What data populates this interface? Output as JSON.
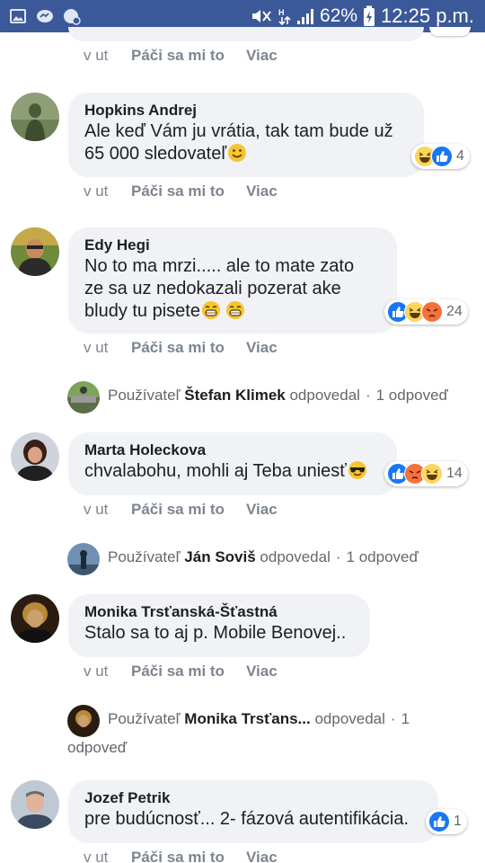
{
  "status": {
    "battery_pct": "62%",
    "time": "12:25 p.m."
  },
  "colors": {
    "facebook_blue": "#3b5998",
    "bubble": "#f0f2f5",
    "like": "#1877f2",
    "meta_gray": "#7d8590"
  },
  "top_actions": {
    "time": "v ut",
    "like": "Páči sa mi to",
    "more": "Viac"
  },
  "comments": [
    {
      "author": "Hopkins Andrej",
      "lines": [
        "Ale keď Vám ju vrátia, tak tam bude už",
        "65 000 sledovateľ"
      ],
      "line_emojis": [
        "",
        "smile"
      ],
      "reactions": [
        "haha",
        "like"
      ],
      "reaction_count": "4",
      "time": "v ut",
      "like": "Páči sa mi to",
      "more": "Viac"
    },
    {
      "author": "Edy Hegi",
      "lines": [
        "No to ma mrzi..... ale to mate zato",
        "ze sa uz nedokazali pozerat ake",
        "bludy tu pisete"
      ],
      "line_emojis": [
        "",
        "",
        "grin grin"
      ],
      "reactions": [
        "like",
        "haha",
        "angry"
      ],
      "reaction_count": "24",
      "time": "v ut",
      "like": "Páči sa mi to",
      "more": "Viac",
      "reply": {
        "prefix": "Používateľ",
        "name": "Štefan Klimek",
        "verb": "odpovedal",
        "count": "1 odpoveď"
      }
    },
    {
      "author": "Marta Holeckova",
      "lines": [
        "chvalabohu, mohli aj Teba uniesť"
      ],
      "line_emojis": [
        "sunglasses"
      ],
      "reactions": [
        "like",
        "angry",
        "haha"
      ],
      "reaction_count": "14",
      "time": "v ut",
      "like": "Páči sa mi to",
      "more": "Viac",
      "reply": {
        "prefix": "Používateľ",
        "name": "Ján Soviš",
        "verb": "odpovedal",
        "count": "1 odpoveď"
      }
    },
    {
      "author": "Monika Trsťanská-Šťastná",
      "lines": [
        "Stalo sa to aj p. Mobile Benovej.."
      ],
      "line_emojis": [
        ""
      ],
      "reactions": [],
      "reaction_count": "",
      "time": "v ut",
      "like": "Páči sa mi to",
      "more": "Viac",
      "reply": {
        "prefix": "Používateľ",
        "name": "Monika Trsťans...",
        "verb": "odpovedal",
        "count": "1",
        "count_tail": "odpoveď"
      }
    },
    {
      "author": "Jozef Petrik",
      "lines": [
        "pre budúcnosť... 2- fázová autentifikácia."
      ],
      "line_emojis": [
        ""
      ],
      "reactions": [
        "like"
      ],
      "reaction_count": "1",
      "time": "v ut",
      "like": "Páči sa mi to",
      "more": "Viac"
    }
  ]
}
